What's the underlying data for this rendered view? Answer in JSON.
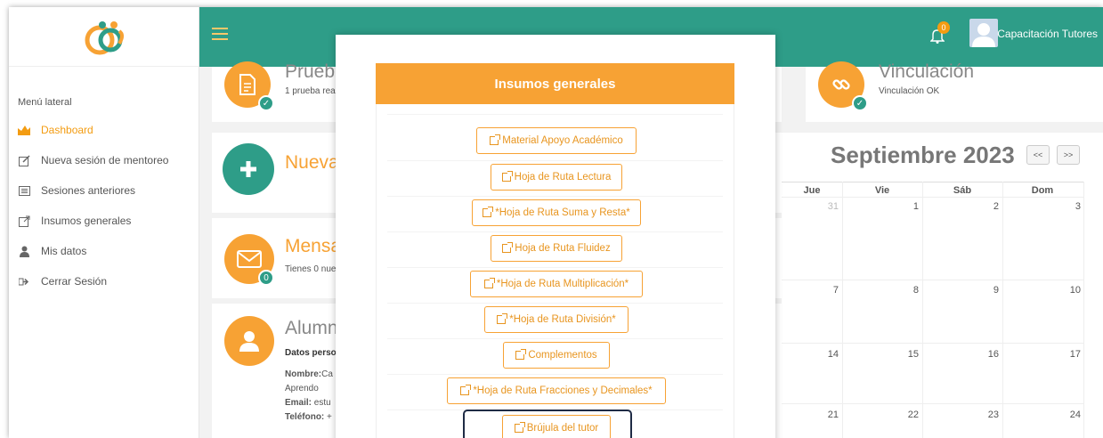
{
  "sidebar": {
    "menu_title": "Menú lateral",
    "items": [
      {
        "label": "Dashboard",
        "icon": "chart-area-icon",
        "active": true
      },
      {
        "label": "Nueva sesión de mentoreo",
        "icon": "edit-icon",
        "active": false
      },
      {
        "label": "Sesiones anteriores",
        "icon": "list-icon",
        "active": false
      },
      {
        "label": "Insumos generales",
        "icon": "external-link-icon",
        "active": false
      },
      {
        "label": "Mis datos",
        "icon": "user-icon",
        "active": false
      },
      {
        "label": "Cerrar Sesión",
        "icon": "sign-out-icon",
        "active": false
      }
    ]
  },
  "topbar": {
    "notification_count": "0",
    "user_name": "Capacitación Tutores"
  },
  "cards": {
    "prueba": {
      "title": "Prueb",
      "subtitle": "1 prueba rea"
    },
    "nueva": {
      "title": "Nueva"
    },
    "mensajes": {
      "title": "Mensa",
      "subtitle": "Tienes 0 nue",
      "badge": "0"
    },
    "alumno": {
      "title": "Alumn",
      "section": "Datos perso",
      "nombre_label": "Nombre:",
      "nombre_value": "Ca",
      "line2": "Aprendo",
      "email_label": "Email:",
      "email_value": "estu",
      "telefono_label": "Teléfono:",
      "telefono_value": "+"
    },
    "vinculacion": {
      "title": "Vinculación",
      "subtitle": "Vinculación OK"
    }
  },
  "calendar": {
    "title": "Septiembre 2023",
    "prev_label": "<<",
    "next_label": ">>",
    "headers": [
      "Jue",
      "Vie",
      "Sáb",
      "Dom"
    ],
    "rows": [
      [
        "31",
        "1",
        "2",
        "3"
      ],
      [
        "7",
        "8",
        "9",
        "10"
      ],
      [
        "14",
        "15",
        "16",
        "17"
      ],
      [
        "21",
        "22",
        "23",
        "24"
      ]
    ]
  },
  "modal": {
    "title": "Insumos generales",
    "buttons": [
      "Material Apoyo Académico",
      "Hoja de Ruta Lectura",
      "*Hoja de Ruta Suma y Resta*",
      "Hoja de Ruta Fluidez",
      "*Hoja de Ruta Multiplicación*",
      "*Hoja de Ruta División*",
      "Complementos",
      "*Hoja de Ruta Fracciones y Decimales*",
      "Brújula del tutor"
    ]
  },
  "colors": {
    "accent": "#f7a234",
    "brand": "#2e9d88"
  }
}
